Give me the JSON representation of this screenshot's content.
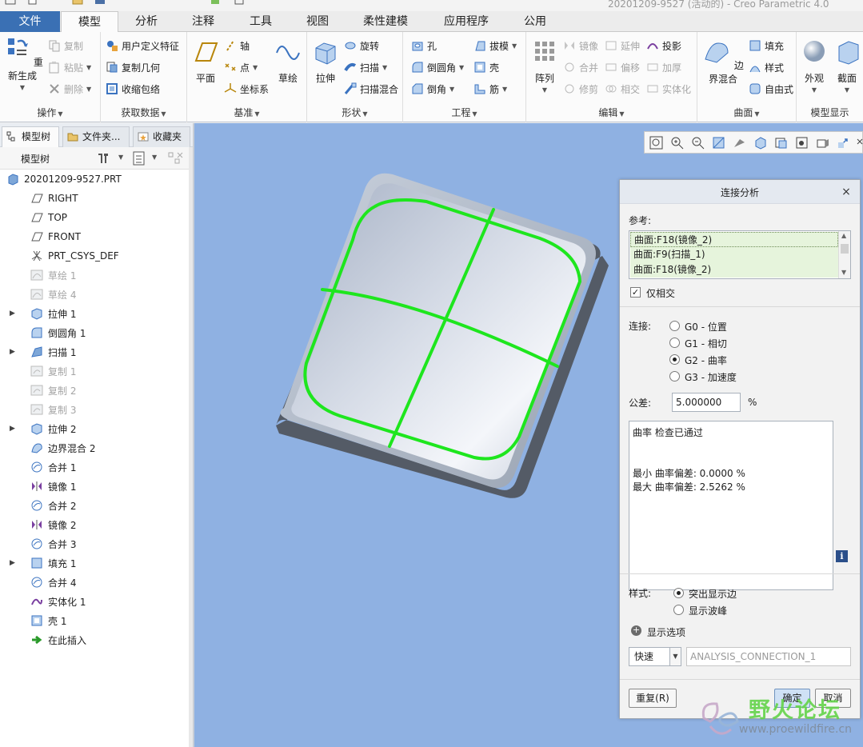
{
  "title_fragment": "20201209-9527 (活动的) - Creo Parametric 4.0",
  "tabs": [
    "文件",
    "模型",
    "分析",
    "注释",
    "工具",
    "视图",
    "柔性建模",
    "应用程序",
    "公用"
  ],
  "ribbon": {
    "operations": {
      "label": "操作",
      "regenerate": "重新生成",
      "copy": "复制",
      "paste": "粘贴",
      "delete": "删除"
    },
    "get_data": {
      "label": "获取数据",
      "udf": "用户定义特征",
      "copy_geom": "复制几何",
      "shrinkwrap": "收缩包络"
    },
    "datum": {
      "label": "基准",
      "plane": "平面",
      "axis": "轴",
      "point": "点",
      "csys": "坐标系",
      "sketch": "草绘"
    },
    "shapes": {
      "label": "形状",
      "extrude": "拉伸",
      "revolve": "旋转",
      "sweep": "扫描",
      "swept_blend": "扫描混合"
    },
    "engineering": {
      "label": "工程",
      "hole": "孔",
      "draft": "拔模",
      "round": "倒圆角",
      "shell": "壳",
      "chamfer": "倒角",
      "rib": "筋"
    },
    "editing": {
      "label": "编辑",
      "pattern": "阵列",
      "mirror": "镜像",
      "extend": "延伸",
      "project": "投影",
      "merge": "合并",
      "offset": "偏移",
      "thicken": "加厚",
      "trim": "修剪",
      "intersect": "相交",
      "solidify": "实体化"
    },
    "surfaces": {
      "label": "曲面",
      "boundary_blend": "边界混合",
      "fill": "填充",
      "style": "样式",
      "freestyle": "自由式"
    },
    "display": {
      "label": "模型显示",
      "appearance": "外观",
      "section": "截面"
    }
  },
  "nav_tabs": [
    "模型树",
    "文件夹...",
    "收藏夹"
  ],
  "tree_header": "模型树",
  "tree": [
    {
      "label": "20201209-9527.PRT",
      "icon": "part-icon",
      "expand": "",
      "suppressed": false,
      "root": true
    },
    {
      "label": "RIGHT",
      "icon": "datum-plane-icon",
      "expand": "",
      "suppressed": false
    },
    {
      "label": "TOP",
      "icon": "datum-plane-icon",
      "expand": "",
      "suppressed": false
    },
    {
      "label": "FRONT",
      "icon": "datum-plane-icon",
      "expand": "",
      "suppressed": false
    },
    {
      "label": "PRT_CSYS_DEF",
      "icon": "csys-icon",
      "expand": "",
      "suppressed": false
    },
    {
      "label": "草绘 1",
      "icon": "sketch-icon",
      "expand": "",
      "suppressed": true
    },
    {
      "label": "草绘 4",
      "icon": "sketch-icon",
      "expand": "",
      "suppressed": true
    },
    {
      "label": "拉伸 1",
      "icon": "extrude-icon",
      "expand": "▶",
      "suppressed": false
    },
    {
      "label": "倒圆角 1",
      "icon": "round-icon",
      "expand": "",
      "suppressed": false
    },
    {
      "label": "扫描 1",
      "icon": "sweep-icon",
      "expand": "▶",
      "suppressed": false
    },
    {
      "label": "复制 1",
      "icon": "copy-icon",
      "expand": "",
      "suppressed": true
    },
    {
      "label": "复制 2",
      "icon": "copy-icon",
      "expand": "",
      "suppressed": true
    },
    {
      "label": "复制 3",
      "icon": "copy-icon",
      "expand": "",
      "suppressed": true
    },
    {
      "label": "拉伸 2",
      "icon": "extrude-icon",
      "expand": "▶",
      "suppressed": false
    },
    {
      "label": "边界混合 2",
      "icon": "boundary-blend-icon",
      "expand": "",
      "suppressed": false
    },
    {
      "label": "合并 1",
      "icon": "merge-icon",
      "expand": "",
      "suppressed": false
    },
    {
      "label": "镜像 1",
      "icon": "mirror-icon",
      "expand": "",
      "suppressed": false
    },
    {
      "label": "合并 2",
      "icon": "merge-icon",
      "expand": "",
      "suppressed": false
    },
    {
      "label": "镜像 2",
      "icon": "mirror-icon",
      "expand": "",
      "suppressed": false
    },
    {
      "label": "合并 3",
      "icon": "merge-icon",
      "expand": "",
      "suppressed": false
    },
    {
      "label": "填充 1",
      "icon": "fill-icon",
      "expand": "▶",
      "suppressed": false
    },
    {
      "label": "合并 4",
      "icon": "merge-icon",
      "expand": "",
      "suppressed": false
    },
    {
      "label": "实体化 1",
      "icon": "solidify-icon",
      "expand": "",
      "suppressed": false
    },
    {
      "label": "壳 1",
      "icon": "shell-icon",
      "expand": "",
      "suppressed": false
    },
    {
      "label": "在此插入",
      "icon": "insert-here-icon",
      "expand": "",
      "suppressed": false
    }
  ],
  "dialog": {
    "title": "连接分析",
    "close": "×",
    "reference_label": "参考:",
    "references": [
      "曲面:F18(镜像_2)",
      "曲面:F9(扫描_1)",
      "曲面:F18(镜像_2)"
    ],
    "intersect_only": "仅相交",
    "intersect_only_checked": true,
    "connection_label": "连接:",
    "connection_options": [
      "G0 - 位置",
      "G1 - 相切",
      "G2 - 曲率",
      "G3 - 加速度"
    ],
    "connection_selected": 2,
    "tolerance_label": "公差:",
    "tolerance_value": "5.000000",
    "tolerance_unit": "%",
    "result_status": "曲率 检查已通过",
    "result_min": "最小 曲率偏差: 0.0000 %",
    "result_max": "最大 曲率偏差: 2.5262 %",
    "style_label": "样式:",
    "style_options": [
      "突出显示边",
      "显示波峰"
    ],
    "style_selected": 0,
    "display_options": "显示选项",
    "mode": "快速",
    "analysis_name": "ANALYSIS_CONNECTION_1",
    "repeat": "重复(R)",
    "ok": "确定",
    "cancel": "取消"
  },
  "watermark": {
    "text": "野火论坛",
    "url": "www.proewildfire.cn"
  },
  "colors": {
    "accent": "#3a70b4",
    "viewport": "#8fb1e2",
    "highlight_edge": "#1ee61e",
    "ref_row": "#e6f4dc",
    "model_top": "#d7dde8",
    "model_side": "#545b66"
  }
}
